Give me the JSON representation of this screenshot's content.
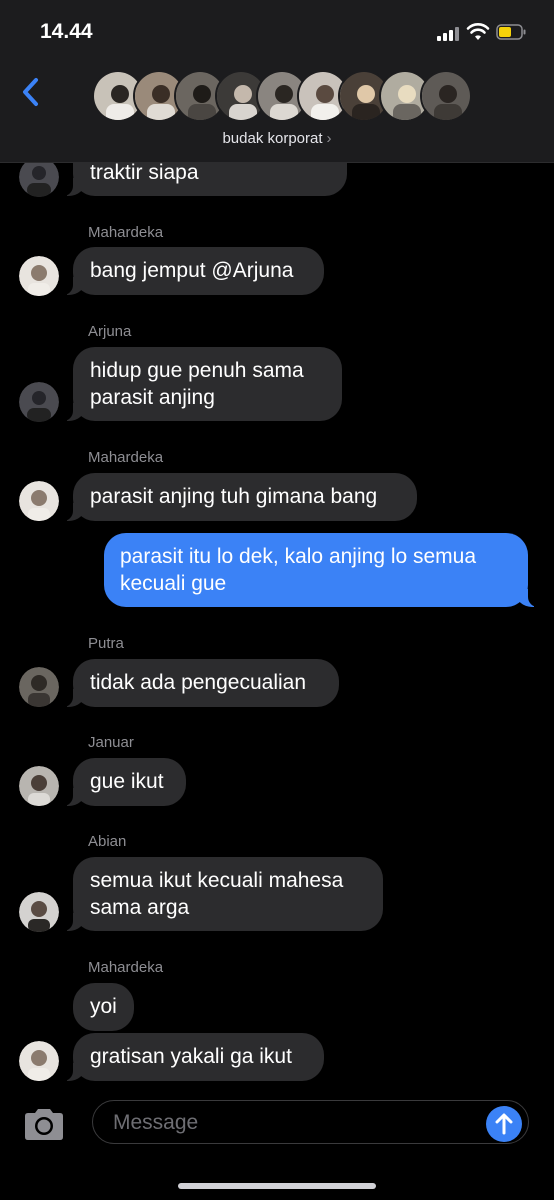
{
  "status_bar": {
    "time": "14.44"
  },
  "header": {
    "group_name": "budak korporat",
    "chevron": "›",
    "back_icon": "chevron-left-icon",
    "avatar_colors": [
      "#7a7a72",
      "#9a8a7a",
      "#6b6660",
      "#3c3a38",
      "#8a8580",
      "#c9c2bb",
      "#4a4038",
      "#b0aca0",
      "#5e5a56"
    ]
  },
  "messages": [
    {
      "sender": "",
      "text_lines": [
        "traktir siapa"
      ],
      "direction": "in",
      "avatar_color": "#4a4a50"
    },
    {
      "sender": "Mahardeka",
      "text_lines": [
        "bang jemput @Arjuna"
      ],
      "direction": "in",
      "avatar_color": "#d9d4cf"
    },
    {
      "sender": "Arjuna",
      "text_lines": [
        "hidup gue penuh sama",
        "parasit anjing"
      ],
      "direction": "in",
      "avatar_color": "#4a4a50"
    },
    {
      "sender": "Mahardeka",
      "text_lines": [
        "parasit anjing tuh gimana bang"
      ],
      "direction": "in",
      "avatar_color": "#d9d4cf"
    },
    {
      "sender": "",
      "text_lines": [
        "parasit itu lo dek, kalo anjing lo semua",
        "kecuali gue"
      ],
      "direction": "out"
    },
    {
      "sender": "Putra",
      "text_lines": [
        "tidak ada pengecualian"
      ],
      "direction": "in",
      "avatar_color": "#5a5650"
    },
    {
      "sender": "Januar",
      "text_lines": [
        "gue ikut"
      ],
      "direction": "in",
      "avatar_color": "#a8a5a0"
    },
    {
      "sender": "Abian",
      "text_lines": [
        "semua ikut kecuali mahesa",
        "sama arga"
      ],
      "direction": "in",
      "avatar_color": "#c8c6c4"
    },
    {
      "sender": "Mahardeka",
      "text_lines": [
        "yoi"
      ],
      "direction": "in"
    },
    {
      "sender": "",
      "text_lines": [
        "gratisan yakali ga ikut"
      ],
      "direction": "in",
      "avatar_color": "#d9d4cf"
    }
  ],
  "composer": {
    "placeholder": "Message",
    "camera_icon": "camera-icon",
    "send_icon": "arrow-up-icon",
    "accent": "#3b82f6"
  }
}
